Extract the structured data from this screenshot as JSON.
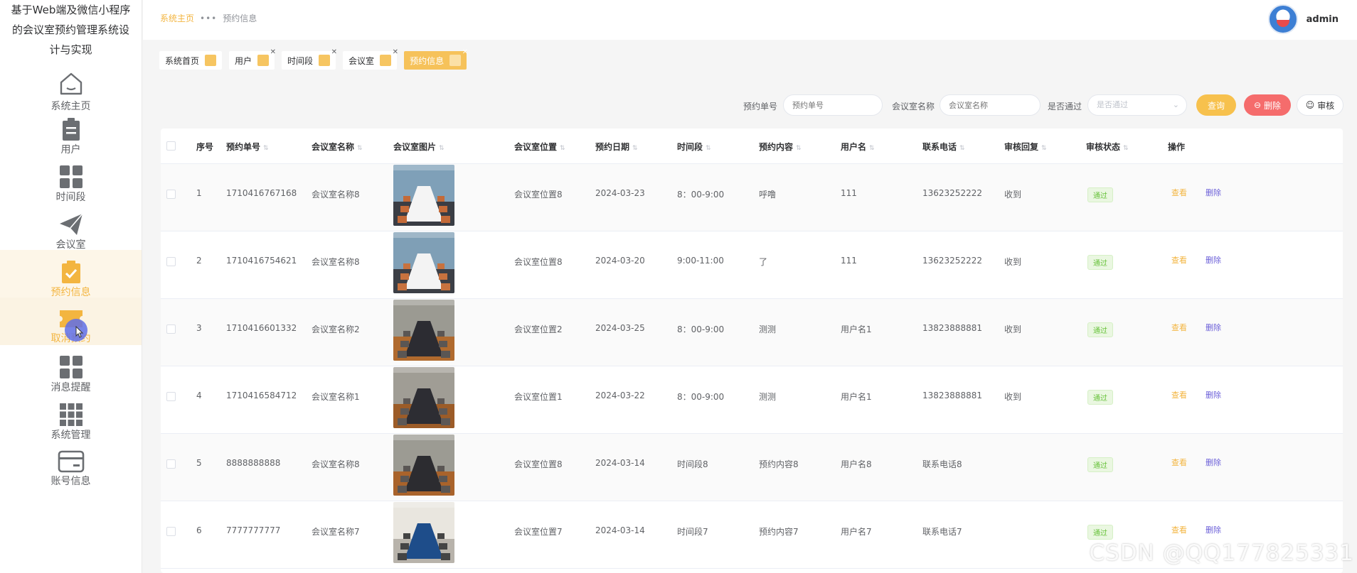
{
  "app": {
    "title_line1": "基于Web端及微信小程序",
    "title_line2": "的会议室预约管理系统设",
    "title_line3": "计与实现"
  },
  "sidebar": {
    "items": [
      {
        "label": "系统主页",
        "icon": "home-icon"
      },
      {
        "label": "用户",
        "icon": "clipboard-icon"
      },
      {
        "label": "时间段",
        "icon": "grid-icon"
      },
      {
        "label": "会议室",
        "icon": "paper-plane-icon"
      },
      {
        "label": "预约信息",
        "icon": "clipboard-check-icon"
      },
      {
        "label": "取消预约",
        "icon": "ticket-icon"
      },
      {
        "label": "消息提醒",
        "icon": "grid-icon"
      },
      {
        "label": "系统管理",
        "icon": "apps-icon"
      },
      {
        "label": "账号信息",
        "icon": "card-icon"
      }
    ]
  },
  "header": {
    "breadcrumb_home": "系统主页",
    "breadcrumb_sep": "•••",
    "breadcrumb_current": "预约信息",
    "username": "admin"
  },
  "tags": [
    {
      "label": "系统首页"
    },
    {
      "label": "用户"
    },
    {
      "label": "时间段"
    },
    {
      "label": "会议室"
    },
    {
      "label": "预约信息"
    }
  ],
  "search": {
    "booking_no_label": "预约单号",
    "booking_no_placeholder": "预约单号",
    "room_name_label": "会议室名称",
    "room_name_placeholder": "会议室名称",
    "passed_label": "是否通过",
    "passed_placeholder": "是否通过",
    "query_button": "查询",
    "delete_button": "删除",
    "audit_button": "审核"
  },
  "table": {
    "headers": [
      "序号",
      "预约单号",
      "会议室名称",
      "会议室图片",
      "会议室位置",
      "预约日期",
      "时间段",
      "预约内容",
      "用户名",
      "联系电话",
      "审核回复",
      "审核状态",
      "操作"
    ],
    "view_label": "查看",
    "delete_label": "删除",
    "rows": [
      {
        "idx": "1",
        "no": "1710416767168",
        "room": "会议室名称8",
        "location": "会议室位置8",
        "date": "2024-03-23",
        "slot": "8：00-9:00",
        "content": "呼噜",
        "user": "111",
        "phone": "13623252222",
        "reply": "收到",
        "status": "通过"
      },
      {
        "idx": "2",
        "no": "1710416754621",
        "room": "会议室名称8",
        "location": "会议室位置8",
        "date": "2024-03-20",
        "slot": "9:00-11:00",
        "content": "了",
        "user": "111",
        "phone": "13623252222",
        "reply": "收到",
        "status": "通过"
      },
      {
        "idx": "3",
        "no": "1710416601332",
        "room": "会议室名称2",
        "location": "会议室位置2",
        "date": "2024-03-25",
        "slot": "8：00-9:00",
        "content": "测测",
        "user": "用户名1",
        "phone": "13823888881",
        "reply": "收到",
        "status": "通过"
      },
      {
        "idx": "4",
        "no": "1710416584712",
        "room": "会议室名称1",
        "location": "会议室位置1",
        "date": "2024-03-22",
        "slot": "8：00-9:00",
        "content": "测测",
        "user": "用户名1",
        "phone": "13823888881",
        "reply": "收到",
        "status": "通过"
      },
      {
        "idx": "5",
        "no": "8888888888",
        "room": "会议室名称8",
        "location": "会议室位置8",
        "date": "2024-03-14",
        "slot": "时间段8",
        "content": "预约内容8",
        "user": "用户名8",
        "phone": "联系电话8",
        "reply": "",
        "status": "通过"
      },
      {
        "idx": "6",
        "no": "7777777777",
        "room": "会议室名称7",
        "location": "会议室位置7",
        "date": "2024-03-14",
        "slot": "时间段7",
        "content": "预约内容7",
        "user": "用户名7",
        "phone": "联系电话7",
        "reply": "",
        "status": "通过"
      }
    ]
  },
  "watermark": "CSDN @QQ177825331"
}
